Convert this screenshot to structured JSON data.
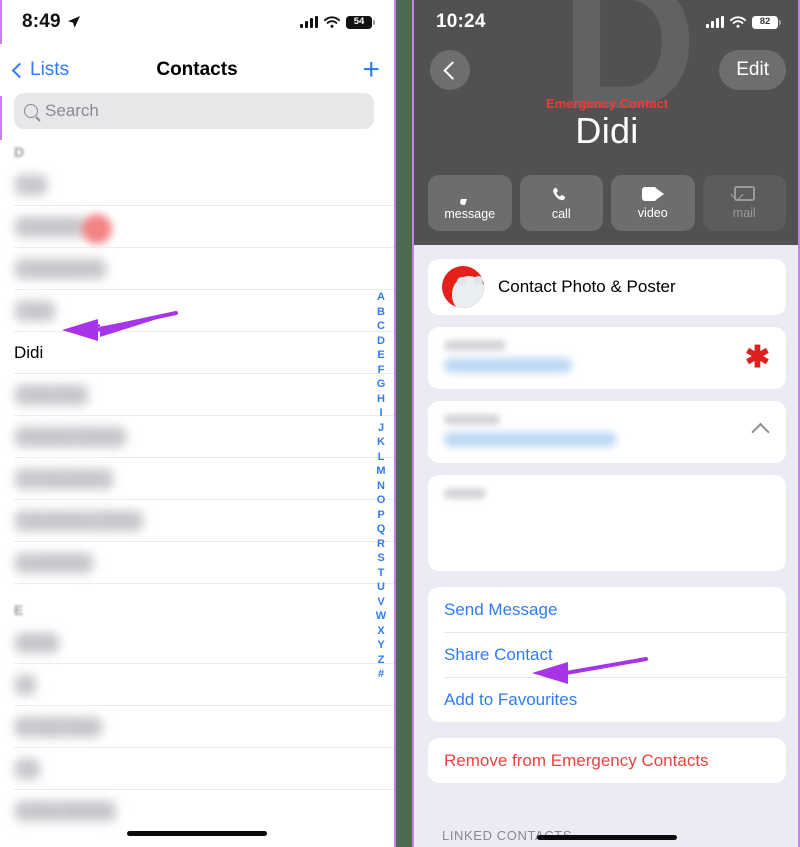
{
  "left_panel": {
    "status_bar": {
      "time": "8:49",
      "location_icon": "location-arrow-icon",
      "signal_icon": "cellular-bars-icon",
      "wifi_icon": "wifi-icon",
      "battery_level": "54"
    },
    "nav": {
      "back_label": "Lists",
      "title": "Contacts",
      "add_label": "+"
    },
    "search": {
      "placeholder": "Search",
      "icon": "search-icon"
    },
    "sections": [
      {
        "header": "D",
        "redacted": true,
        "rows": [
          {
            "name": "Dq",
            "redacted": true,
            "marker": "red-dot"
          },
          {
            "name": "Daanish",
            "redacted": true,
            "marker": "red-dot"
          },
          {
            "name": "Deepanshi",
            "redacted": true
          },
          {
            "name": "Dev",
            "redacted": true
          }
        ]
      },
      {
        "header": "",
        "rows": [
          {
            "name": "Didi",
            "redacted": false,
            "annotated": true
          }
        ]
      },
      {
        "header": "",
        "rows": [
          {
            "name": "Didi Didi",
            "redacted": true
          },
          {
            "name": "Dipsha Sinha",
            "redacted": true
          },
          {
            "name": "Dr Anushka",
            "redacted": true
          },
          {
            "name": "Darshana Shah",
            "redacted": true
          },
          {
            "name": "Dumbidu",
            "redacted": true
          }
        ]
      },
      {
        "header": "E",
        "redacted": true,
        "rows": [
          {
            "name": "Ekta",
            "redacted": true
          },
          {
            "name": "E",
            "redacted": true
          },
          {
            "name": "Emily Ray",
            "redacted": true
          },
          {
            "name": "El",
            "redacted": true
          },
          {
            "name": "Esha Mehta",
            "redacted": true
          }
        ]
      }
    ],
    "alphabet_index": [
      "A",
      "B",
      "C",
      "D",
      "E",
      "F",
      "G",
      "H",
      "I",
      "J",
      "K",
      "L",
      "M",
      "N",
      "O",
      "P",
      "Q",
      "R",
      "S",
      "T",
      "U",
      "V",
      "W",
      "X",
      "Y",
      "Z",
      "#"
    ]
  },
  "right_panel": {
    "status_bar": {
      "time": "10:24",
      "signal_icon": "cellular-bars-icon",
      "wifi_icon": "wifi-icon",
      "battery_level": "82"
    },
    "hero": {
      "back_icon": "chevron-left-icon",
      "edit_label": "Edit",
      "badge": "Emergency Contact",
      "name": "Didi",
      "watermark_letter": "D"
    },
    "quick_actions": [
      {
        "label": "message",
        "icon": "message-bubble-icon",
        "disabled": false
      },
      {
        "label": "call",
        "icon": "phone-handset-icon",
        "disabled": false
      },
      {
        "label": "video",
        "icon": "video-camera-icon",
        "disabled": false
      },
      {
        "label": "mail",
        "icon": "envelope-icon",
        "disabled": true
      }
    ],
    "photo_poster_row": {
      "label": "Contact Photo & Poster",
      "avatar": "polar-bear-avatar"
    },
    "info_cards": [
      {
        "kind": "redacted-field",
        "trailing_icon": "red-asterisk-icon"
      },
      {
        "kind": "redacted-field",
        "trailing_icon": "chevron-right-icon"
      },
      {
        "kind": "redacted-notes"
      }
    ],
    "links": [
      {
        "label": "Send Message",
        "style": "blue"
      },
      {
        "label": "Share Contact",
        "style": "blue",
        "annotated": true
      },
      {
        "label": "Add to Favourites",
        "style": "blue"
      }
    ],
    "destructive": {
      "label": "Remove from Emergency Contacts",
      "style": "red"
    },
    "linked_contacts_header": "LINKED CONTACTS"
  },
  "annotations": {
    "arrow_color": "#a734e8",
    "arrows": [
      {
        "target": "contact-row-didi"
      },
      {
        "target": "share-contact-link"
      }
    ]
  },
  "colors": {
    "ios_blue": "#2f7cf6",
    "ios_red": "#e8433c",
    "emergency_red": "#ef3b34",
    "gap_green": "#4e6a4e",
    "panel_border_purple": "#c77ef0"
  }
}
